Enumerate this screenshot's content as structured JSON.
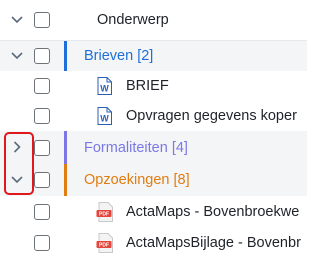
{
  "header": {
    "column_label": "Onderwerp"
  },
  "groups": [
    {
      "label": "Brieven [2]",
      "color": "#1e6fd9",
      "expanded": true,
      "items": [
        {
          "label": "BRIEF",
          "icon": "word-doc-icon"
        },
        {
          "label": "Opvragen gegevens koper",
          "icon": "word-doc-icon"
        }
      ]
    },
    {
      "label": "Formaliteiten [4]",
      "color": "#7b78e6",
      "expanded": false,
      "items": []
    },
    {
      "label": "Opzoekingen [8]",
      "color": "#e07d10",
      "expanded": true,
      "items": [
        {
          "label": "ActaMaps - Bovenbroekwe",
          "icon": "pdf-icon"
        },
        {
          "label": "ActaMapsBijlage - Bovenbr",
          "icon": "pdf-icon"
        }
      ]
    }
  ],
  "colors": {
    "highlight_box": "#e0181e",
    "pdf_red": "#e5443b",
    "word_blue": "#2b5fb4"
  }
}
